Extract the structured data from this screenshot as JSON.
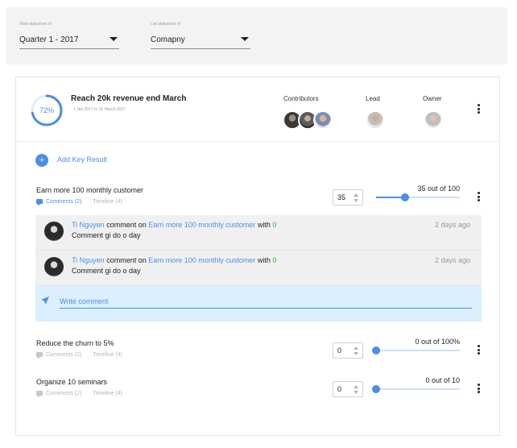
{
  "filters": {
    "view": {
      "label": "View objectives of",
      "value": "Quarter 1 - 2017"
    },
    "list": {
      "label": "List objectives of",
      "value": "Comapny"
    }
  },
  "objective": {
    "progress_label": "72%",
    "progress": 0.72,
    "title": "Reach 20k revenue end March",
    "dates": "1 Jan 2017 to 31 March 2017",
    "contributors_label": "Contributors",
    "lead_label": "Lead",
    "owner_label": "Owner"
  },
  "add_key_result": {
    "icon": "+",
    "label": "Add Key Result"
  },
  "key_results": [
    {
      "title": "Earn more 100 monthly customer",
      "comments_label": "Comments (2)",
      "timeline_label": "Timeline (4)",
      "value": "35",
      "progress_text": "35 out of 100",
      "progress": 0.35,
      "expanded": true
    },
    {
      "title": "Reduce the churn to 5%",
      "comments_label": "Comments (2)",
      "timeline_label": "Timeline (4)",
      "value": "0",
      "progress_text": "0 out of 100%",
      "progress": 0,
      "expanded": false
    },
    {
      "title": "Organize 10 seminars",
      "comments_label": "Comments (2)",
      "timeline_label": "Timeline (4)",
      "value": "0",
      "progress_text": "0 out of 10",
      "progress": 0,
      "expanded": false
    }
  ],
  "comments": [
    {
      "author": "Ti Nguyen",
      "verb": "comment on",
      "target": "Earn more 100 monthly customer",
      "with_word": "with",
      "value": "0",
      "text": "Comment gi do o day",
      "time": "2 days ago"
    },
    {
      "author": "Ti Nguyen",
      "verb": "comment on",
      "target": "Earn more 100 monthly customer",
      "with_word": "with",
      "value": "0",
      "text": "Comment gi do o day",
      "time": "2 days ago"
    }
  ],
  "write_comment": {
    "placeholder": "Write comment"
  },
  "colors": {
    "accent": "#4a8ee8",
    "comment_bg": "#f0f0f0",
    "write_bg": "#dcefff",
    "positive": "#3aa83a"
  },
  "icons": {
    "comments": "chat-bubble-icon",
    "send": "send-icon",
    "more": "more-vertical-icon",
    "dropdown": "caret-down-icon"
  }
}
